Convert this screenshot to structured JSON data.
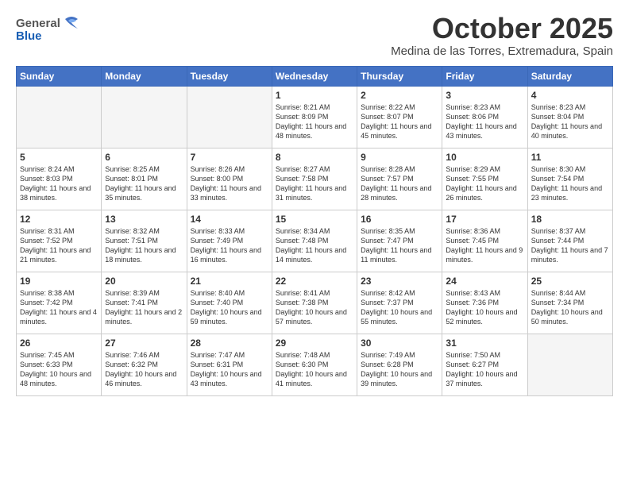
{
  "header": {
    "logo_line1": "General",
    "logo_line2": "Blue",
    "month": "October 2025",
    "location": "Medina de las Torres, Extremadura, Spain"
  },
  "days_of_week": [
    "Sunday",
    "Monday",
    "Tuesday",
    "Wednesday",
    "Thursday",
    "Friday",
    "Saturday"
  ],
  "weeks": [
    [
      {
        "day": "",
        "info": ""
      },
      {
        "day": "",
        "info": ""
      },
      {
        "day": "",
        "info": ""
      },
      {
        "day": "1",
        "info": "Sunrise: 8:21 AM\nSunset: 8:09 PM\nDaylight: 11 hours\nand 48 minutes."
      },
      {
        "day": "2",
        "info": "Sunrise: 8:22 AM\nSunset: 8:07 PM\nDaylight: 11 hours\nand 45 minutes."
      },
      {
        "day": "3",
        "info": "Sunrise: 8:23 AM\nSunset: 8:06 PM\nDaylight: 11 hours\nand 43 minutes."
      },
      {
        "day": "4",
        "info": "Sunrise: 8:23 AM\nSunset: 8:04 PM\nDaylight: 11 hours\nand 40 minutes."
      }
    ],
    [
      {
        "day": "5",
        "info": "Sunrise: 8:24 AM\nSunset: 8:03 PM\nDaylight: 11 hours\nand 38 minutes."
      },
      {
        "day": "6",
        "info": "Sunrise: 8:25 AM\nSunset: 8:01 PM\nDaylight: 11 hours\nand 35 minutes."
      },
      {
        "day": "7",
        "info": "Sunrise: 8:26 AM\nSunset: 8:00 PM\nDaylight: 11 hours\nand 33 minutes."
      },
      {
        "day": "8",
        "info": "Sunrise: 8:27 AM\nSunset: 7:58 PM\nDaylight: 11 hours\nand 31 minutes."
      },
      {
        "day": "9",
        "info": "Sunrise: 8:28 AM\nSunset: 7:57 PM\nDaylight: 11 hours\nand 28 minutes."
      },
      {
        "day": "10",
        "info": "Sunrise: 8:29 AM\nSunset: 7:55 PM\nDaylight: 11 hours\nand 26 minutes."
      },
      {
        "day": "11",
        "info": "Sunrise: 8:30 AM\nSunset: 7:54 PM\nDaylight: 11 hours\nand 23 minutes."
      }
    ],
    [
      {
        "day": "12",
        "info": "Sunrise: 8:31 AM\nSunset: 7:52 PM\nDaylight: 11 hours\nand 21 minutes."
      },
      {
        "day": "13",
        "info": "Sunrise: 8:32 AM\nSunset: 7:51 PM\nDaylight: 11 hours\nand 18 minutes."
      },
      {
        "day": "14",
        "info": "Sunrise: 8:33 AM\nSunset: 7:49 PM\nDaylight: 11 hours\nand 16 minutes."
      },
      {
        "day": "15",
        "info": "Sunrise: 8:34 AM\nSunset: 7:48 PM\nDaylight: 11 hours\nand 14 minutes."
      },
      {
        "day": "16",
        "info": "Sunrise: 8:35 AM\nSunset: 7:47 PM\nDaylight: 11 hours\nand 11 minutes."
      },
      {
        "day": "17",
        "info": "Sunrise: 8:36 AM\nSunset: 7:45 PM\nDaylight: 11 hours\nand 9 minutes."
      },
      {
        "day": "18",
        "info": "Sunrise: 8:37 AM\nSunset: 7:44 PM\nDaylight: 11 hours\nand 7 minutes."
      }
    ],
    [
      {
        "day": "19",
        "info": "Sunrise: 8:38 AM\nSunset: 7:42 PM\nDaylight: 11 hours\nand 4 minutes."
      },
      {
        "day": "20",
        "info": "Sunrise: 8:39 AM\nSunset: 7:41 PM\nDaylight: 11 hours\nand 2 minutes."
      },
      {
        "day": "21",
        "info": "Sunrise: 8:40 AM\nSunset: 7:40 PM\nDaylight: 10 hours\nand 59 minutes."
      },
      {
        "day": "22",
        "info": "Sunrise: 8:41 AM\nSunset: 7:38 PM\nDaylight: 10 hours\nand 57 minutes."
      },
      {
        "day": "23",
        "info": "Sunrise: 8:42 AM\nSunset: 7:37 PM\nDaylight: 10 hours\nand 55 minutes."
      },
      {
        "day": "24",
        "info": "Sunrise: 8:43 AM\nSunset: 7:36 PM\nDaylight: 10 hours\nand 52 minutes."
      },
      {
        "day": "25",
        "info": "Sunrise: 8:44 AM\nSunset: 7:34 PM\nDaylight: 10 hours\nand 50 minutes."
      }
    ],
    [
      {
        "day": "26",
        "info": "Sunrise: 7:45 AM\nSunset: 6:33 PM\nDaylight: 10 hours\nand 48 minutes."
      },
      {
        "day": "27",
        "info": "Sunrise: 7:46 AM\nSunset: 6:32 PM\nDaylight: 10 hours\nand 46 minutes."
      },
      {
        "day": "28",
        "info": "Sunrise: 7:47 AM\nSunset: 6:31 PM\nDaylight: 10 hours\nand 43 minutes."
      },
      {
        "day": "29",
        "info": "Sunrise: 7:48 AM\nSunset: 6:30 PM\nDaylight: 10 hours\nand 41 minutes."
      },
      {
        "day": "30",
        "info": "Sunrise: 7:49 AM\nSunset: 6:28 PM\nDaylight: 10 hours\nand 39 minutes."
      },
      {
        "day": "31",
        "info": "Sunrise: 7:50 AM\nSunset: 6:27 PM\nDaylight: 10 hours\nand 37 minutes."
      },
      {
        "day": "",
        "info": ""
      }
    ]
  ]
}
